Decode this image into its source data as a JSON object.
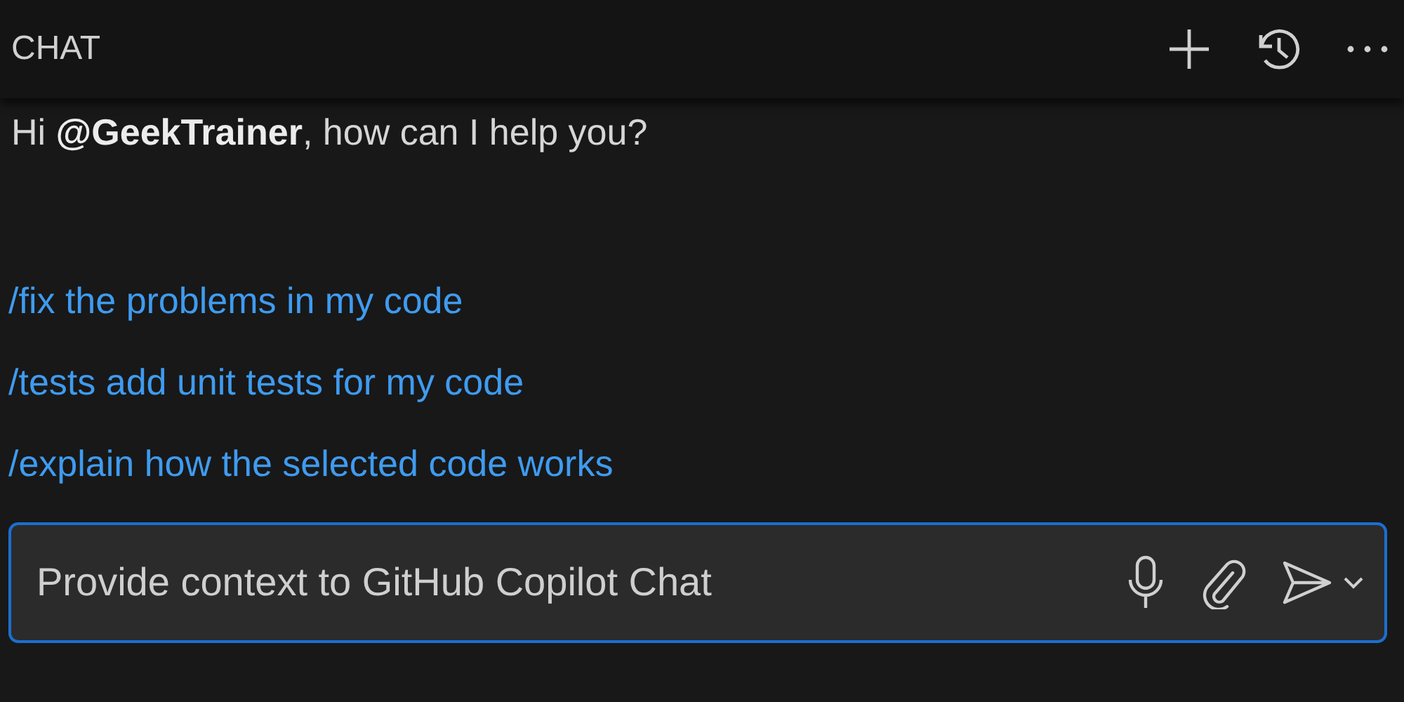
{
  "header": {
    "title": "CHAT"
  },
  "greeting": "Hi **@GeekTrainer**, how can I help you?",
  "suggestions": [
    "/fix the problems in my code",
    "/tests add unit tests for my code",
    "/explain how the selected code works"
  ],
  "input": {
    "placeholder": "Provide context to GitHub Copilot Chat"
  }
}
